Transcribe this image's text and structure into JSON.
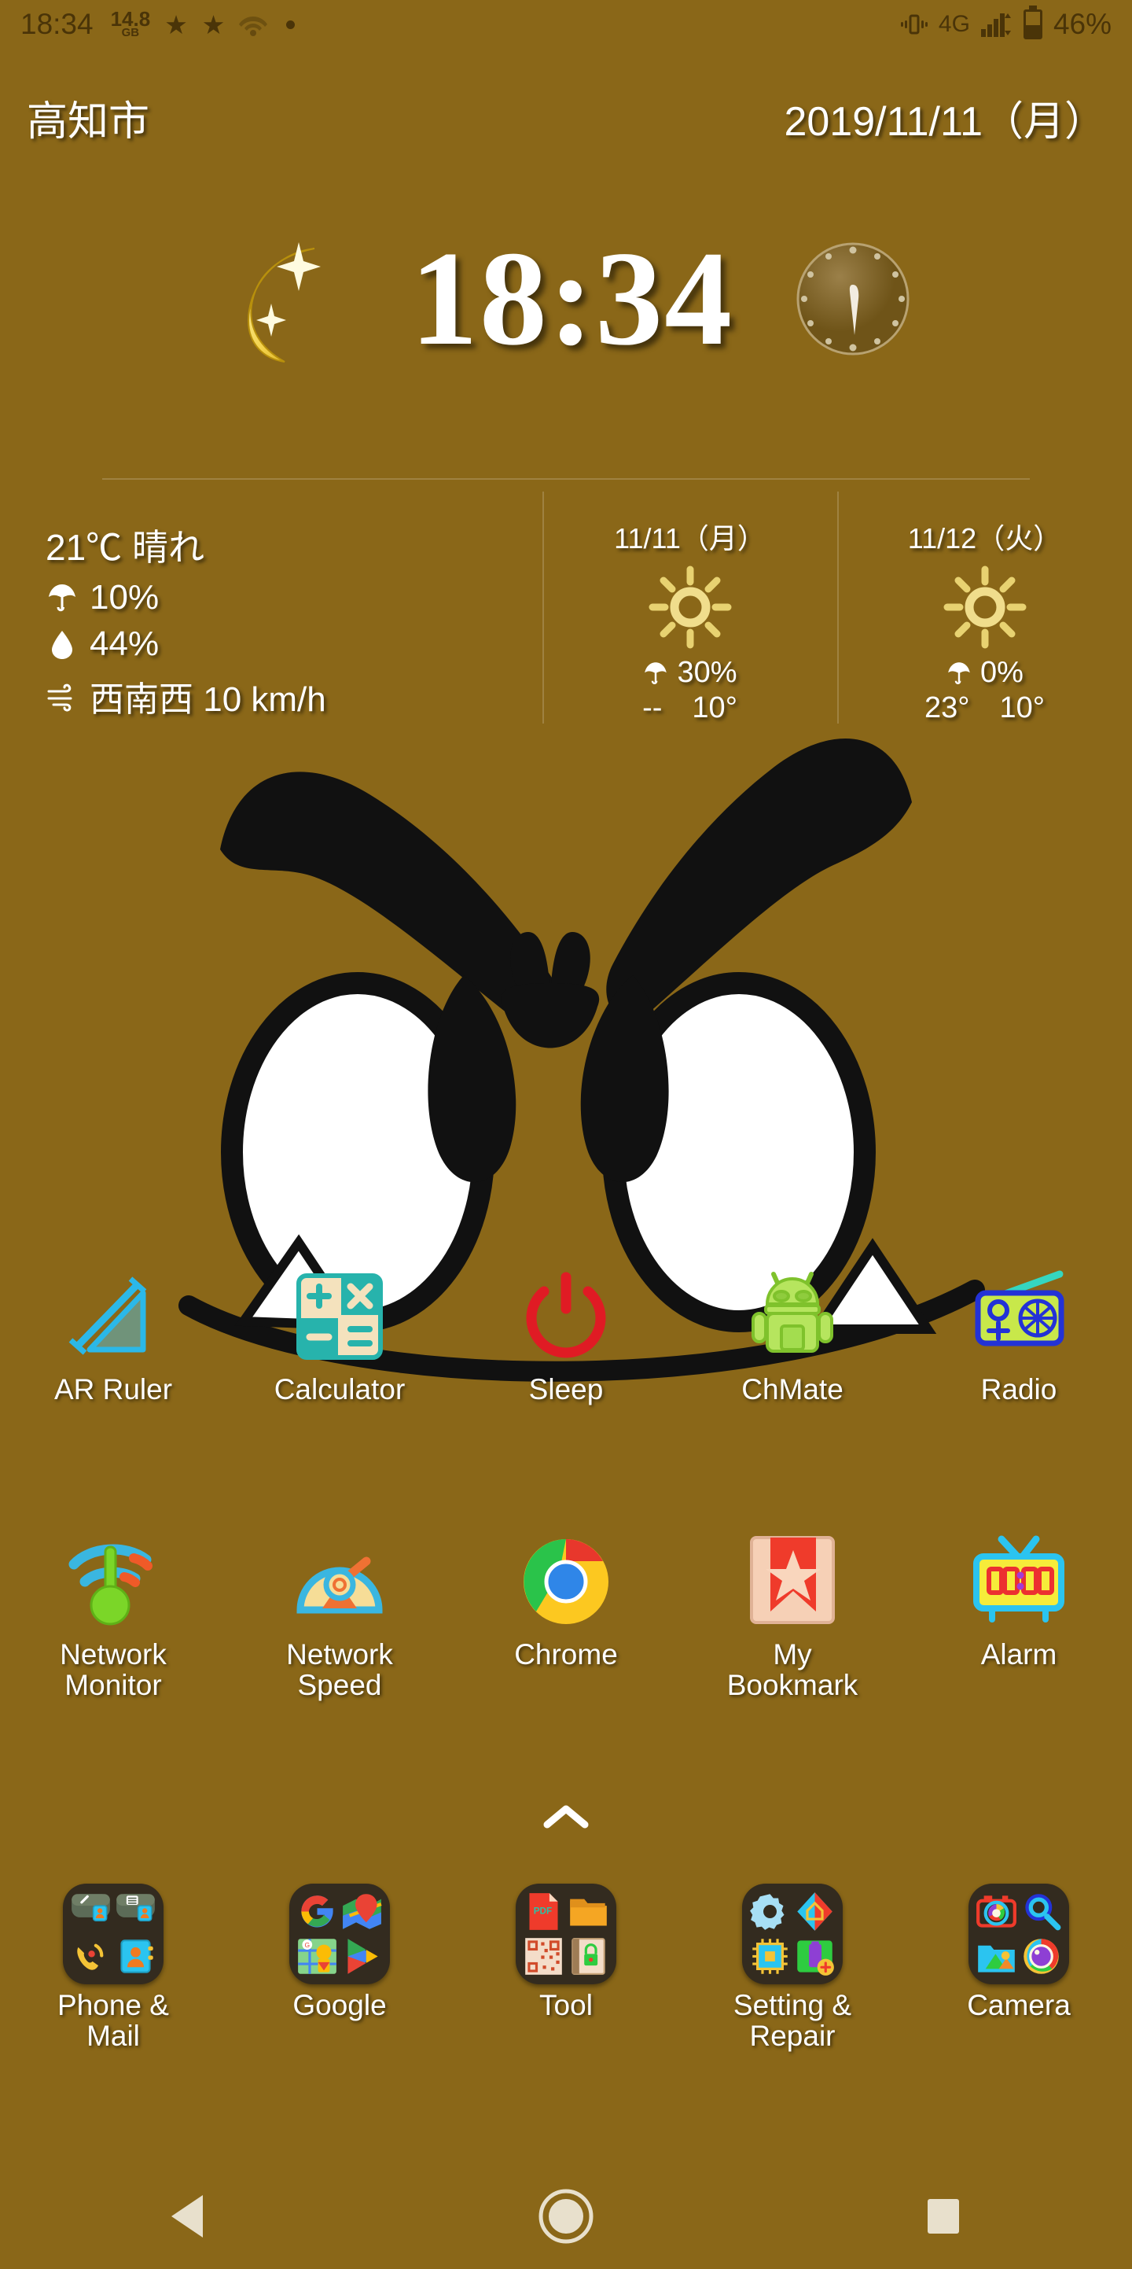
{
  "colors": {
    "background": "#8a6718",
    "status_text": "#4a3408",
    "widget_text": "#ffffff",
    "folder_bg": "#332b1f",
    "nav_icon": "#e8e0cc"
  },
  "status_bar": {
    "clock": "18:34",
    "storage_value": "14.8",
    "storage_unit": "GB",
    "star1_icon": "star-icon",
    "star2_icon": "star-icon",
    "wifi_icon": "wifi-icon",
    "dot_icon": "dot-icon",
    "vibrate_icon": "vibrate-icon",
    "network_type": "4G",
    "signal_icon": "signal-bars-icon",
    "battery_icon": "battery-icon",
    "battery_percent": "46%"
  },
  "header": {
    "location": "高知市",
    "date": "2019/11/11（月）"
  },
  "clock_widget": {
    "moon_icon": "crescent-moon-icon",
    "time": "18:34",
    "dial_icon": "analog-clock-dial-icon"
  },
  "weather": {
    "current": {
      "temperature": "21℃ 晴れ",
      "rain_icon": "umbrella-icon",
      "rain_chance": "10%",
      "humidity_icon": "water-drop-icon",
      "humidity": "44%",
      "wind_icon": "wind-icon",
      "wind": "西南西 10 km/h"
    },
    "forecast": [
      {
        "date": "11/11（月）",
        "condition_icon": "sun-icon",
        "rain_icon": "umbrella-icon",
        "rain_chance": "30%",
        "high": "--",
        "low": "10°"
      },
      {
        "date": "11/12（火）",
        "condition_icon": "sun-icon",
        "rain_icon": "umbrella-icon",
        "rain_chance": "0%",
        "high": "23°",
        "low": "10°"
      }
    ]
  },
  "app_rows": [
    {
      "apps": [
        {
          "label": "AR Ruler",
          "icon": "ar-ruler-icon"
        },
        {
          "label": "Calculator",
          "icon": "calculator-icon"
        },
        {
          "label": "Sleep",
          "icon": "power-sleep-icon"
        },
        {
          "label": "ChMate",
          "icon": "chmate-android-icon"
        },
        {
          "label": "Radio",
          "icon": "radio-icon"
        }
      ]
    },
    {
      "apps": [
        {
          "label": "Network\nMonitor",
          "icon": "network-monitor-icon"
        },
        {
          "label": "Network\nSpeed",
          "icon": "network-speed-icon"
        },
        {
          "label": "Chrome",
          "icon": "chrome-icon"
        },
        {
          "label": "My\nBookmark",
          "icon": "bookmark-icon"
        },
        {
          "label": "Alarm",
          "icon": "alarm-clock-icon"
        }
      ]
    }
  ],
  "drawer": {
    "arrow_icon": "chevron-up-icon"
  },
  "dock": {
    "folders": [
      {
        "label": "Phone &\nMail",
        "icon": "folder-phone-mail-icon"
      },
      {
        "label": "Google",
        "icon": "folder-google-icon"
      },
      {
        "label": "Tool",
        "icon": "folder-tool-icon"
      },
      {
        "label": "Setting &\nRepair",
        "icon": "folder-setting-repair-icon"
      },
      {
        "label": "Camera",
        "icon": "folder-camera-icon"
      }
    ]
  },
  "nav_bar": {
    "back_icon": "back-triangle-icon",
    "home_icon": "home-circle-icon",
    "recents_icon": "recents-square-icon"
  }
}
